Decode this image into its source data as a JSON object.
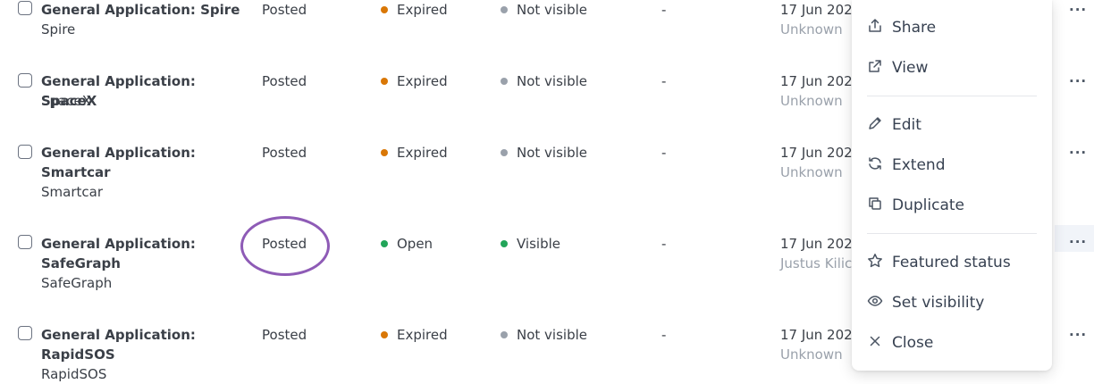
{
  "rows": [
    {
      "title": "General Application: Spire",
      "company": "Spire",
      "stage": "Posted",
      "status": "Expired",
      "visibility": "Not visible",
      "dash": "-",
      "date": "17 Jun 202",
      "owner": "Unknown",
      "more": "···"
    },
    {
      "title": "General Application: SpaceX",
      "company": "SpaceX",
      "stage": "Posted",
      "status": "Expired",
      "visibility": "Not visible",
      "dash": "-",
      "date": "17 Jun 202",
      "owner": "Unknown",
      "more": "···"
    },
    {
      "title": "General Application: Smartcar",
      "company": "Smartcar",
      "stage": "Posted",
      "status": "Expired",
      "visibility": "Not visible",
      "dash": "-",
      "date": "17 Jun 202",
      "owner": "Unknown",
      "more": "···"
    },
    {
      "title": "General Application: SafeGraph",
      "company": "SafeGraph",
      "stage": "Posted",
      "status": "Open",
      "visibility": "Visible",
      "dash": "-",
      "date": "17 Jun 202",
      "owner": "Justus Kilic",
      "more": "···"
    },
    {
      "title": "General Application: RapidSOS",
      "company": "RapidSOS",
      "stage": "Posted",
      "status": "Expired",
      "visibility": "Not visible",
      "dash": "-",
      "date": "17 Jun 202",
      "owner": "Unknown",
      "more": "···"
    }
  ],
  "menu": {
    "share": "Share",
    "view": "View",
    "edit": "Edit",
    "extend": "Extend",
    "duplicate": "Duplicate",
    "featured": "Featured status",
    "set_visibility": "Set visibility",
    "close": "Close"
  },
  "colors": {
    "expired": "#d97706",
    "open": "#22a559",
    "not_visible": "#9aa1ab",
    "visible": "#22a559",
    "annotation": "#8e5bb6"
  }
}
